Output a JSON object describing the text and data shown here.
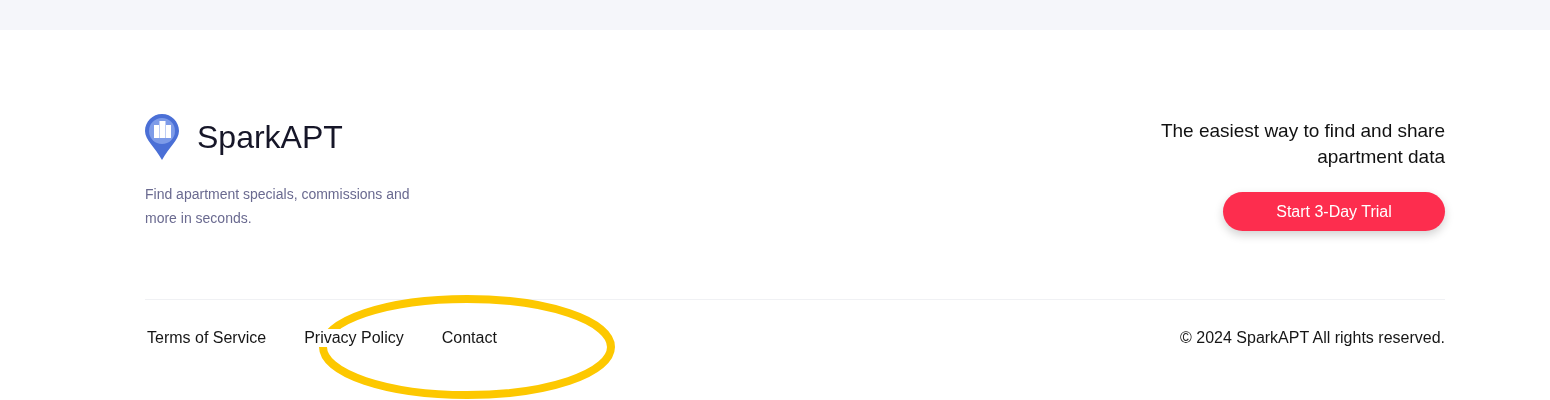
{
  "brand": {
    "name": "SparkAPT",
    "description": "Find apartment specials, commissions and more in seconds."
  },
  "cta": {
    "headline": "The easiest way to find and share apartment data",
    "button": "Start 3-Day Trial"
  },
  "footer_links": [
    "Terms of Service",
    "Privacy Policy",
    "Contact"
  ],
  "copyright": "© 2024 SparkAPT All rights reserved.",
  "annotation": {
    "kind": "ellipse"
  }
}
